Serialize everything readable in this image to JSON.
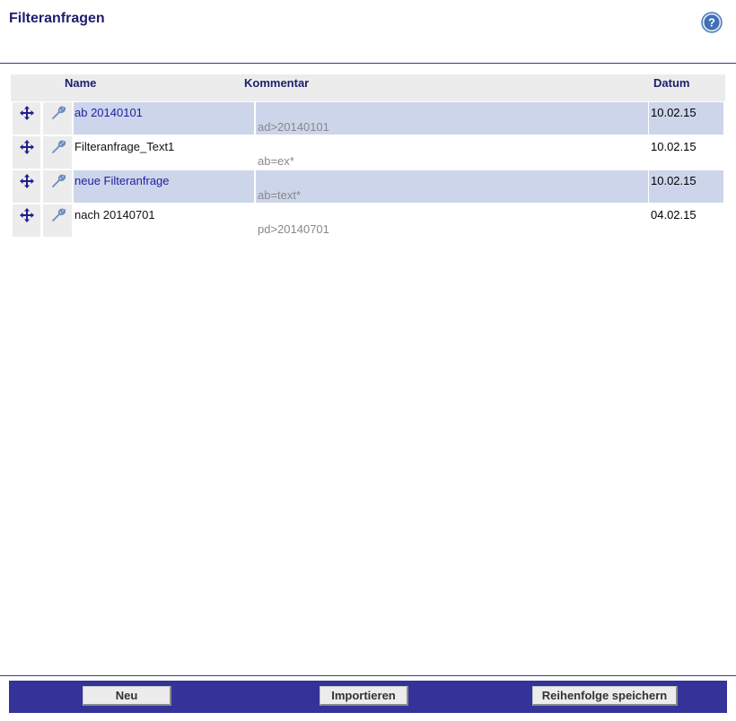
{
  "page": {
    "title": "Filteranfragen"
  },
  "help": {
    "icon": "help-icon",
    "symbol": "?"
  },
  "table": {
    "headers": {
      "name": "Name",
      "comment": "Kommentar",
      "date": "Datum"
    },
    "rows": [
      {
        "name": "ab 20140101",
        "comment": "ad>20140101",
        "date": "10.02.15",
        "highlighted": true
      },
      {
        "name": "Filteranfrage_Text1",
        "comment": "ab=ex*",
        "date": "10.02.15",
        "highlighted": false
      },
      {
        "name": "neue Filteranfrage",
        "comment": "ab=text*",
        "date": "10.02.15",
        "highlighted": true
      },
      {
        "name": "nach 20140701",
        "comment": "pd>20140701",
        "date": "04.02.15",
        "highlighted": false
      }
    ]
  },
  "footer": {
    "new_label": "Neu",
    "import_label": "Importieren",
    "save_order_label": "Reihenfolge speichern"
  },
  "colors": {
    "accent": "#333399",
    "title": "#1e1e6e",
    "row_highlight": "#ccd5ea",
    "link": "#1f1fa0"
  }
}
